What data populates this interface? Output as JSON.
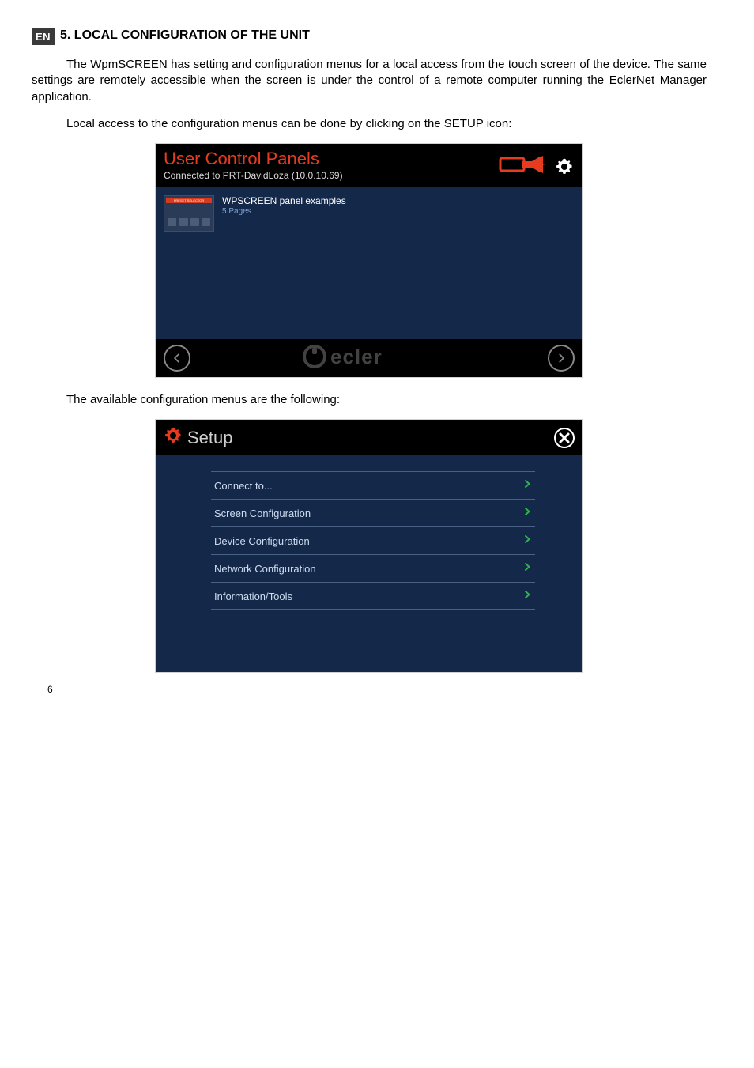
{
  "lang_badge": "EN",
  "section_heading": "5. LOCAL CONFIGURATION OF THE UNIT",
  "para1": "The WpmSCREEN has setting and configuration menus for a local access from the touch screen of the device. The same settings are remotely accessible when the screen is under the control of a remote computer running the EclerNet Manager application.",
  "para2": "Local access to the configuration menus can be done by clicking on the SETUP icon:",
  "para3": "The available configuration menus are the following:",
  "page_number": "6",
  "ucp": {
    "title": "User Control Panels",
    "subtitle": "Connected to PRT-DavidLoza (10.0.10.69)",
    "card": {
      "thumb_label": "PRESET SELECTOR",
      "title": "WPSCREEN panel examples",
      "subtitle": "5 Pages"
    },
    "footer_logo_text": "ecler"
  },
  "setup": {
    "title": "Setup",
    "items": [
      {
        "label": "Connect to..."
      },
      {
        "label": "Screen Configuration"
      },
      {
        "label": "Device Configuration"
      },
      {
        "label": "Network Configuration"
      },
      {
        "label": "Information/Tools"
      }
    ]
  }
}
